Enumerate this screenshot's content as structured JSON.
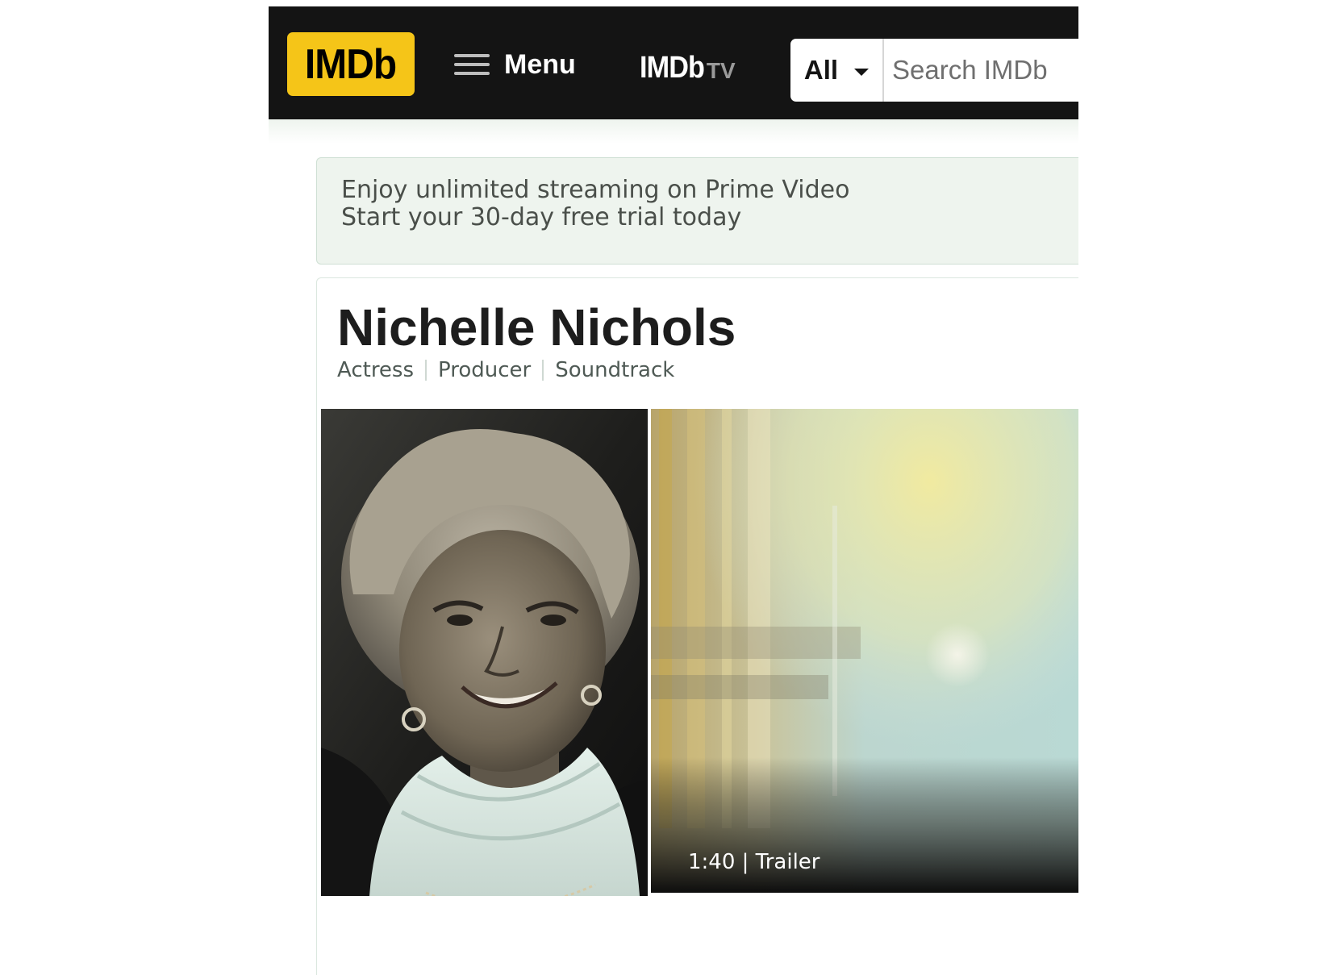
{
  "header": {
    "logo_text": "IMDb",
    "menu_label": "Menu",
    "imdbtv_main": "IMDb",
    "imdbtv_suffix": "TV",
    "search": {
      "category": "All",
      "placeholder": "Search IMDb"
    }
  },
  "promo": {
    "line1": "Enjoy unlimited streaming on Prime Video",
    "line2": "Start your 30-day free trial today"
  },
  "person": {
    "name": "Nichelle Nichols",
    "roles": [
      "Actress",
      "Producer",
      "Soundtrack"
    ]
  },
  "media": {
    "video_caption": "1:40 | Trailer"
  },
  "colors": {
    "brand_yellow": "#f5c518",
    "nav_background": "#141414",
    "promo_background": "#eef4ee"
  },
  "icons": {
    "menu": "hamburger-icon",
    "dropdown": "caret-down-icon"
  }
}
